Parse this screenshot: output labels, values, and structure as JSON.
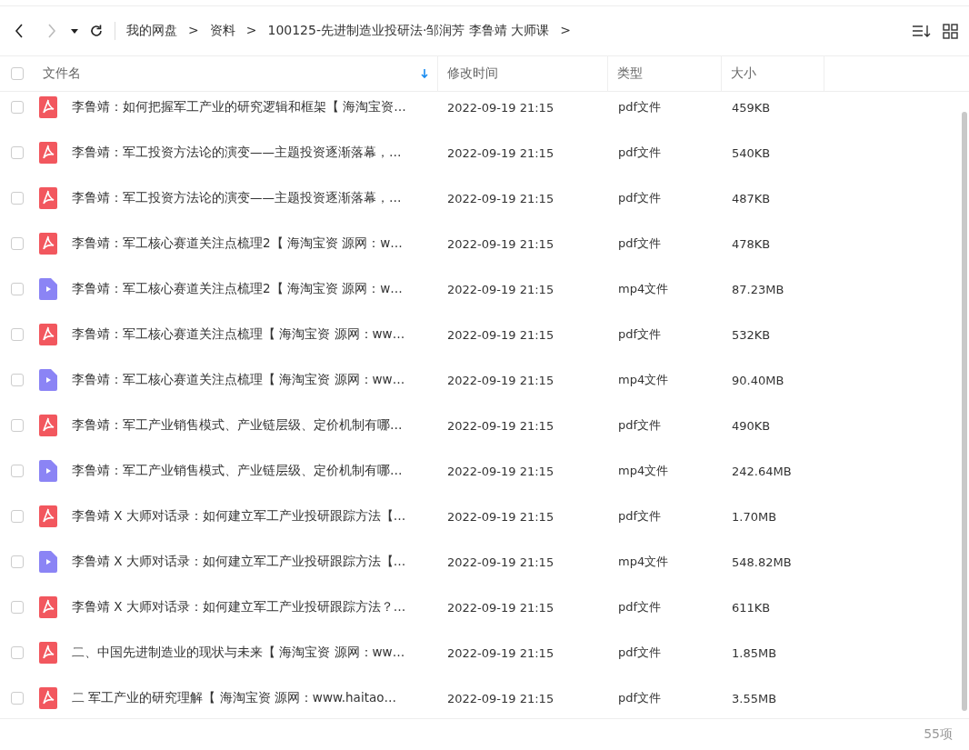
{
  "nav": {
    "back": {
      "disabled": false
    },
    "forward": {
      "disabled": true
    }
  },
  "breadcrumb": [
    {
      "label": "我的网盘",
      "separator": ">"
    },
    {
      "label": "资料",
      "separator": ">"
    },
    {
      "label": "100125-先进制造业投研法·邹润芳 李鲁靖  大师课",
      "separator": ">"
    }
  ],
  "header": {
    "checked": false,
    "columns": [
      {
        "label": "文件名",
        "sorted": true
      },
      {
        "label": "修改时间",
        "sorted": false
      },
      {
        "label": "类型",
        "sorted": false
      },
      {
        "label": "大小",
        "sorted": false
      }
    ]
  },
  "rows": [
    {
      "kind": "pdf",
      "selected": false,
      "name": "李鲁靖：如何把握军工产业的研究逻辑和框架【 海淘宝资…",
      "modified": "2022-09-19 21:15",
      "type": "pdf文件",
      "size": "459KB"
    },
    {
      "kind": "pdf",
      "selected": false,
      "name": "李鲁靖：军工投资方法论的演变——主题投资逐渐落幕，…",
      "modified": "2022-09-19 21:15",
      "type": "pdf文件",
      "size": "540KB"
    },
    {
      "kind": "pdf",
      "selected": false,
      "name": "李鲁靖：军工投资方法论的演变——主题投资逐渐落幕，…",
      "modified": "2022-09-19 21:15",
      "type": "pdf文件",
      "size": "487KB"
    },
    {
      "kind": "pdf",
      "selected": false,
      "name": "李鲁靖：军工核心赛道关注点梳理2【 海淘宝资 源网：w…",
      "modified": "2022-09-19 21:15",
      "type": "pdf文件",
      "size": "478KB"
    },
    {
      "kind": "video",
      "selected": false,
      "name": "李鲁靖：军工核心赛道关注点梳理2【 海淘宝资 源网：w…",
      "modified": "2022-09-19 21:15",
      "type": "mp4文件",
      "size": "87.23MB"
    },
    {
      "kind": "pdf",
      "selected": false,
      "name": "李鲁靖：军工核心赛道关注点梳理【 海淘宝资 源网：ww…",
      "modified": "2022-09-19 21:15",
      "type": "pdf文件",
      "size": "532KB"
    },
    {
      "kind": "video",
      "selected": false,
      "name": "李鲁靖：军工核心赛道关注点梳理【 海淘宝资 源网：ww…",
      "modified": "2022-09-19 21:15",
      "type": "mp4文件",
      "size": "90.40MB"
    },
    {
      "kind": "pdf",
      "selected": false,
      "name": "李鲁靖：军工产业销售模式、产业链层级、定价机制有哪…",
      "modified": "2022-09-19 21:15",
      "type": "pdf文件",
      "size": "490KB"
    },
    {
      "kind": "video",
      "selected": false,
      "name": "李鲁靖：军工产业销售模式、产业链层级、定价机制有哪…",
      "modified": "2022-09-19 21:15",
      "type": "mp4文件",
      "size": "242.64MB"
    },
    {
      "kind": "pdf",
      "selected": false,
      "name": "李鲁靖 X 大师对话录：如何建立军工产业投研跟踪方法【…",
      "modified": "2022-09-19 21:15",
      "type": "pdf文件",
      "size": "1.70MB"
    },
    {
      "kind": "video",
      "selected": false,
      "name": "李鲁靖 X 大师对话录：如何建立军工产业投研跟踪方法【…",
      "modified": "2022-09-19 21:15",
      "type": "mp4文件",
      "size": "548.82MB"
    },
    {
      "kind": "pdf",
      "selected": false,
      "name": "李鲁靖 X 大师对话录：如何建立军工产业投研跟踪方法？…",
      "modified": "2022-09-19 21:15",
      "type": "pdf文件",
      "size": "611KB"
    },
    {
      "kind": "pdf",
      "selected": false,
      "name": "二、中国先进制造业的现状与未来【 海淘宝资 源网：ww…",
      "modified": "2022-09-19 21:15",
      "type": "pdf文件",
      "size": "1.85MB"
    },
    {
      "kind": "pdf",
      "selected": false,
      "name": "二 军工产业的研究理解【 海淘宝资 源网：www.haitao…",
      "modified": "2022-09-19 21:15",
      "type": "pdf文件",
      "size": "3.55MB"
    }
  ],
  "status_bar": {
    "count": "55项"
  }
}
